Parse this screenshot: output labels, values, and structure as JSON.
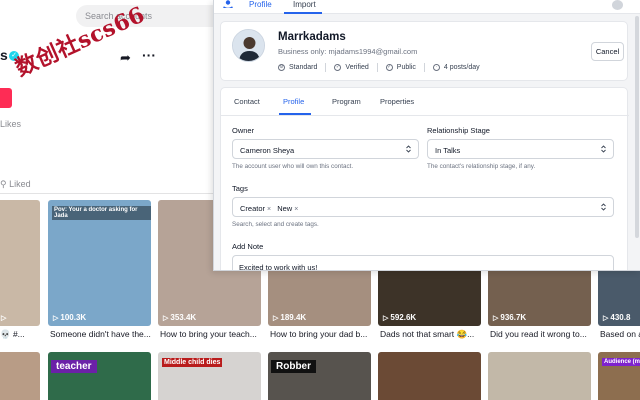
{
  "background": {
    "search_placeholder": "Search accounts",
    "profile_letter": "s",
    "likes_label": "Likes",
    "liked_tab": "Liked",
    "share_icon": "share-icon",
    "more_icon": "more-icon",
    "watermark_text": "数创社scs66",
    "videos_row1": [
      {
        "views": "",
        "caption": "💀 #...",
        "top_caption": ""
      },
      {
        "views": "100.3K",
        "caption": "Someone didn't have the...",
        "top_caption": "Pov: Your a doctor asking for Jada"
      },
      {
        "views": "353.4K",
        "caption": "How to bring your teach...",
        "top_caption": ""
      },
      {
        "views": "189.4K",
        "caption": "How to bring your dad b...",
        "top_caption": ""
      },
      {
        "views": "592.6K",
        "caption": "Dads not that smart 😂...",
        "top_caption": ""
      },
      {
        "views": "936.7K",
        "caption": "Did you read it wrong to...",
        "top_caption": ""
      },
      {
        "views": "430.8",
        "caption": "Based on a",
        "top_caption": ""
      }
    ],
    "videos_row2": [
      {
        "top_caption": ""
      },
      {
        "top_caption": "teacher"
      },
      {
        "top_caption": "Middle child dies"
      },
      {
        "top_caption": "Robber"
      },
      {
        "top_caption": ""
      },
      {
        "top_caption": ""
      },
      {
        "top_caption": "Audience (me)"
      }
    ],
    "thumb_colors": [
      "#c9b8a6",
      "#7ba7c9",
      "#b6a397",
      "#a58f7f",
      "#3d3328",
      "#74604f",
      "#4a5a6a"
    ]
  },
  "panel": {
    "top_tabs": {
      "profile": "Profile",
      "import": "Import"
    },
    "contact": {
      "name": "Marrkadams",
      "email": "Business only: mjadams1994@gmail.com",
      "badges": [
        {
          "icon": "gear-icon",
          "label": "Standard"
        },
        {
          "icon": "check-circle-icon",
          "label": "Verified"
        },
        {
          "icon": "globe-icon",
          "label": "Public"
        },
        {
          "icon": "clock-icon",
          "label": "4 posts/day"
        }
      ],
      "cancel_label": "Cancel"
    },
    "tabs": {
      "contact": "Contact",
      "profile": "Profile",
      "program": "Program",
      "properties": "Properties"
    },
    "owner": {
      "label": "Owner",
      "value": "Cameron Sheya",
      "hint": "The account user who will own this contact."
    },
    "relationship": {
      "label": "Relationship Stage",
      "value": "In Talks",
      "hint": "The contact's relationship stage, if any."
    },
    "tags": {
      "label": "Tags",
      "chips": [
        "Creator",
        "New"
      ],
      "hint": "Search, select and create tags."
    },
    "note": {
      "label": "Add Note",
      "value": "Excited to work with us!"
    },
    "accent": "#2563eb"
  }
}
